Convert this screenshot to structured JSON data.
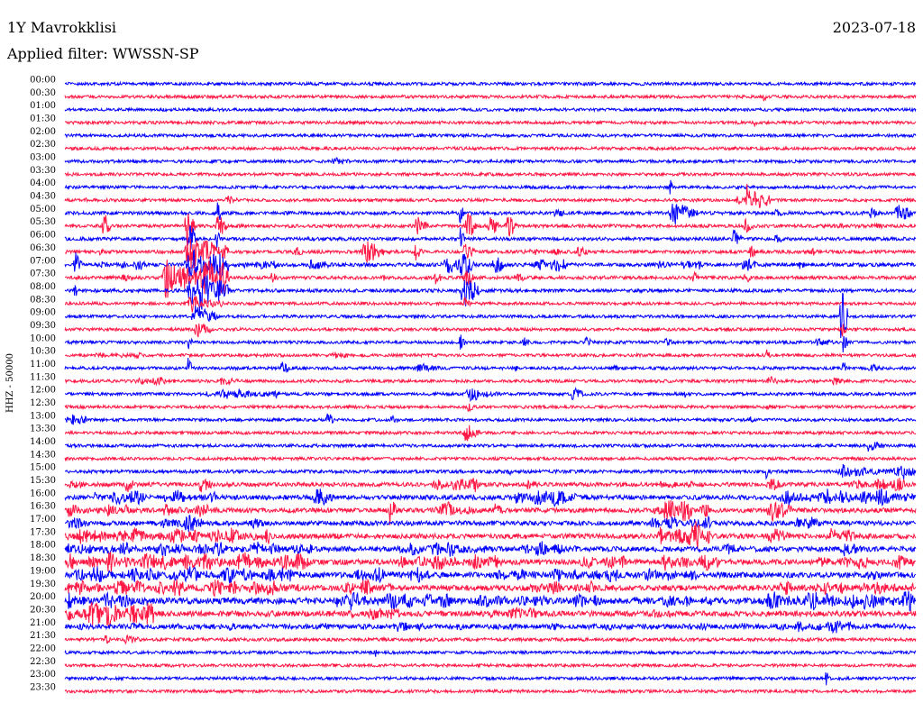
{
  "chart_data": {
    "type": "line",
    "title": "1Y Mavrokklisi",
    "date": "2023-07-18",
    "subtitle": "Applied filter: WWSSN-SP",
    "ylabel": "HHZ - 50000",
    "row_minutes": 30,
    "colors": [
      "#0000ff",
      "#ff1744"
    ],
    "rows": [
      {
        "time": "00:00",
        "noise": 1,
        "events": []
      },
      {
        "time": "00:30",
        "noise": 1,
        "events": [
          [
            24.6,
            24.75,
            3.5
          ]
        ]
      },
      {
        "time": "01:00",
        "noise": 1,
        "events": []
      },
      {
        "time": "01:30",
        "noise": 1,
        "events": [
          [
            24.3,
            24.4,
            3
          ]
        ]
      },
      {
        "time": "02:00",
        "noise": 1,
        "events": []
      },
      {
        "time": "02:30",
        "noise": 1,
        "events": []
      },
      {
        "time": "03:00",
        "noise": 1,
        "events": [
          [
            9.3,
            10.4,
            2.6
          ]
        ]
      },
      {
        "time": "03:30",
        "noise": 1,
        "events": []
      },
      {
        "time": "04:00",
        "noise": 1,
        "events": [
          [
            21.3,
            21.45,
            6
          ]
        ]
      },
      {
        "time": "04:30",
        "noise": 1,
        "events": [
          [
            0.7,
            0.9,
            2.5
          ],
          [
            5.6,
            6.3,
            3
          ],
          [
            23.6,
            24.9,
            7
          ],
          [
            24.0,
            24.2,
            12
          ]
        ]
      },
      {
        "time": "05:00",
        "noise": 1.1,
        "events": [
          [
            5.35,
            5.5,
            10
          ],
          [
            13.9,
            14.05,
            9
          ],
          [
            17.2,
            17.7,
            3.5
          ],
          [
            21.2,
            22.3,
            8
          ],
          [
            25.0,
            25.4,
            3
          ],
          [
            28.3,
            28.8,
            3.5
          ],
          [
            29.2,
            30.0,
            6
          ]
        ]
      },
      {
        "time": "05:30",
        "noise": 1.1,
        "events": [
          [
            1.3,
            1.6,
            10
          ],
          [
            4.2,
            4.6,
            12
          ],
          [
            5.3,
            5.7,
            9
          ],
          [
            12.3,
            12.8,
            7
          ],
          [
            14.1,
            14.5,
            11
          ],
          [
            14.9,
            15.3,
            8
          ],
          [
            15.5,
            16.0,
            8
          ],
          [
            23.9,
            24.3,
            5
          ],
          [
            27.0,
            29.5,
            2
          ]
        ]
      },
      {
        "time": "06:00",
        "noise": 1.1,
        "events": [
          [
            4.3,
            4.6,
            14
          ],
          [
            5.3,
            5.5,
            8
          ],
          [
            13.9,
            14.1,
            8
          ],
          [
            23.5,
            23.9,
            7
          ],
          [
            25.0,
            25.3,
            5
          ]
        ]
      },
      {
        "time": "06:30",
        "noise": 1.1,
        "events": [
          [
            1.2,
            1.4,
            4
          ],
          [
            4.2,
            5.8,
            12
          ],
          [
            8.0,
            8.4,
            5
          ],
          [
            10.4,
            11.3,
            8
          ],
          [
            12.3,
            12.6,
            6
          ],
          [
            14.0,
            14.5,
            6
          ],
          [
            16.1,
            17.5,
            3
          ],
          [
            18.0,
            18.5,
            4
          ],
          [
            24.1,
            24.5,
            5
          ],
          [
            26.3,
            26.6,
            3
          ]
        ]
      },
      {
        "time": "07:00",
        "noise": 1.2,
        "events": [
          [
            0.3,
            0.6,
            10
          ],
          [
            1.2,
            3.0,
            3.5
          ],
          [
            4.2,
            5.8,
            14
          ],
          [
            6.2,
            7.5,
            4
          ],
          [
            8.5,
            9.5,
            4
          ],
          [
            13.2,
            14.5,
            9
          ],
          [
            15.0,
            15.6,
            7
          ],
          [
            16.4,
            17.8,
            6
          ],
          [
            20.8,
            22.5,
            4
          ],
          [
            23.8,
            24.5,
            5
          ],
          [
            25.8,
            26.2,
            3
          ]
        ]
      },
      {
        "time": "07:30",
        "noise": 1.1,
        "events": [
          [
            1.0,
            3.3,
            2.5
          ],
          [
            3.4,
            5.8,
            14
          ],
          [
            7.2,
            7.6,
            4
          ],
          [
            11.0,
            11.4,
            4
          ],
          [
            13.0,
            13.3,
            5
          ],
          [
            14.0,
            14.5,
            6
          ],
          [
            15.9,
            16.3,
            4
          ],
          [
            22.1,
            22.4,
            4
          ],
          [
            23.9,
            24.2,
            5
          ]
        ]
      },
      {
        "time": "08:00",
        "noise": 1.1,
        "events": [
          [
            0.3,
            0.5,
            5
          ],
          [
            4.3,
            5.8,
            16
          ],
          [
            13.9,
            14.6,
            12
          ]
        ]
      },
      {
        "time": "08:30",
        "noise": 1,
        "events": [
          [
            4.3,
            5.6,
            7
          ],
          [
            14.0,
            14.3,
            5
          ]
        ]
      },
      {
        "time": "09:00",
        "noise": 1,
        "events": [
          [
            4.4,
            5.4,
            8
          ],
          [
            27.3,
            27.6,
            20
          ]
        ]
      },
      {
        "time": "09:30",
        "noise": 1,
        "events": [
          [
            4.5,
            5.2,
            6
          ],
          [
            27.35,
            27.55,
            6
          ]
        ]
      },
      {
        "time": "10:00",
        "noise": 1,
        "events": [
          [
            4.3,
            4.5,
            7
          ],
          [
            13.9,
            14.1,
            10
          ],
          [
            16.1,
            16.4,
            4
          ],
          [
            18.3,
            18.6,
            4
          ],
          [
            21.1,
            21.5,
            3
          ],
          [
            26.3,
            27.2,
            3
          ],
          [
            27.4,
            27.6,
            9
          ]
        ]
      },
      {
        "time": "10:30",
        "noise": 1,
        "events": [
          [
            0.8,
            2.8,
            2.5
          ],
          [
            9.3,
            10.4,
            2.5
          ],
          [
            24.7,
            24.9,
            4
          ]
        ]
      },
      {
        "time": "11:00",
        "noise": 1,
        "events": [
          [
            4.3,
            4.5,
            8
          ],
          [
            7.6,
            7.9,
            7
          ],
          [
            12.3,
            13.3,
            3.5
          ],
          [
            15.8,
            16.0,
            3
          ],
          [
            19.3,
            19.6,
            3
          ],
          [
            27.4,
            27.6,
            6
          ],
          [
            28.2,
            29.0,
            3
          ]
        ]
      },
      {
        "time": "11:30",
        "noise": 1,
        "events": [
          [
            2.2,
            4.0,
            3
          ],
          [
            5.3,
            6.3,
            3
          ],
          [
            24.7,
            25.2,
            4
          ],
          [
            27.0,
            27.6,
            3
          ]
        ]
      },
      {
        "time": "12:00",
        "noise": 1,
        "events": [
          [
            4.9,
            7.6,
            4
          ],
          [
            14.0,
            15.3,
            5
          ],
          [
            17.8,
            18.3,
            5
          ],
          [
            21.8,
            22.0,
            3
          ]
        ]
      },
      {
        "time": "12:30",
        "noise": 1,
        "events": [
          [
            14.1,
            14.4,
            5
          ],
          [
            24.7,
            24.9,
            3.5
          ]
        ]
      },
      {
        "time": "13:00",
        "noise": 1,
        "events": [
          [
            0.0,
            0.9,
            5
          ],
          [
            9.2,
            9.5,
            6
          ],
          [
            11.4,
            11.9,
            3
          ],
          [
            24.1,
            24.3,
            3
          ]
        ]
      },
      {
        "time": "13:30",
        "noise": 1,
        "events": [
          [
            14.0,
            14.6,
            7
          ]
        ]
      },
      {
        "time": "14:00",
        "noise": 1,
        "events": [
          [
            28.2,
            28.9,
            4.5
          ]
        ]
      },
      {
        "time": "14:30",
        "noise": 1,
        "events": []
      },
      {
        "time": "15:00",
        "noise": 1.1,
        "events": [
          [
            15.6,
            15.8,
            3
          ],
          [
            24.7,
            24.9,
            8
          ],
          [
            27.0,
            30.0,
            4
          ],
          [
            27.3,
            27.8,
            6
          ],
          [
            29.4,
            30.0,
            6
          ]
        ]
      },
      {
        "time": "15:30",
        "noise": 1.3,
        "events": [
          [
            0.0,
            0.9,
            4
          ],
          [
            2.1,
            2.5,
            6
          ],
          [
            4.7,
            5.2,
            7
          ],
          [
            12.9,
            14.6,
            6
          ],
          [
            16.1,
            16.8,
            4
          ],
          [
            20.9,
            22.2,
            4
          ],
          [
            24.7,
            25.4,
            5
          ],
          [
            27.6,
            30.0,
            5
          ]
        ]
      },
      {
        "time": "16:00",
        "noise": 1.5,
        "events": [
          [
            0.9,
            3.0,
            6
          ],
          [
            3.4,
            5.4,
            5
          ],
          [
            8.7,
            9.5,
            7
          ],
          [
            15.8,
            18.1,
            7
          ],
          [
            25.0,
            30.0,
            6
          ]
        ]
      },
      {
        "time": "16:30",
        "noise": 1.5,
        "events": [
          [
            0.0,
            2.8,
            5
          ],
          [
            3.4,
            5.4,
            5
          ],
          [
            11.4,
            11.7,
            10
          ],
          [
            13.0,
            14.6,
            6
          ],
          [
            15.0,
            15.6,
            5
          ],
          [
            20.6,
            22.8,
            8
          ],
          [
            24.7,
            25.7,
            8
          ]
        ]
      },
      {
        "time": "17:00",
        "noise": 1.5,
        "events": [
          [
            0.0,
            0.9,
            5
          ],
          [
            3.3,
            4.9,
            7
          ],
          [
            6.5,
            7.2,
            4
          ],
          [
            20.6,
            22.8,
            5
          ],
          [
            25.7,
            27.0,
            5
          ]
        ]
      },
      {
        "time": "17:30",
        "noise": 1.7,
        "events": [
          [
            0.0,
            7.3,
            6
          ],
          [
            20.9,
            22.8,
            10
          ],
          [
            24.7,
            25.7,
            6
          ],
          [
            26.9,
            28.2,
            6
          ]
        ]
      },
      {
        "time": "18:00",
        "noise": 1.7,
        "events": [
          [
            0.0,
            8.8,
            5
          ],
          [
            11.7,
            14.9,
            6
          ],
          [
            15.8,
            18.1,
            6
          ],
          [
            23.1,
            24.1,
            4
          ],
          [
            27.3,
            28.2,
            5
          ]
        ]
      },
      {
        "time": "18:30",
        "noise": 1.7,
        "events": [
          [
            0.0,
            8.8,
            7
          ],
          [
            11.7,
            15.5,
            6
          ],
          [
            18.1,
            19.9,
            6
          ],
          [
            20.9,
            23.1,
            7
          ],
          [
            26.3,
            30.0,
            5
          ]
        ]
      },
      {
        "time": "19:00",
        "noise": 1.8,
        "events": [
          [
            0.0,
            8.5,
            6
          ],
          [
            10.1,
            12.9,
            6
          ],
          [
            14.9,
            22.5,
            5
          ],
          [
            28.2,
            28.9,
            5
          ]
        ]
      },
      {
        "time": "19:30",
        "noise": 1.8,
        "events": [
          [
            0.0,
            8.5,
            6
          ],
          [
            9.5,
            11.7,
            6
          ],
          [
            16.1,
            18.7,
            5
          ],
          [
            25.0,
            30.0,
            5
          ]
        ]
      },
      {
        "time": "20:00",
        "noise": 2,
        "events": [
          [
            0.0,
            3.0,
            6
          ],
          [
            9.5,
            13.0,
            7
          ],
          [
            13.0,
            19.0,
            5
          ],
          [
            20.0,
            23.0,
            5
          ],
          [
            24.5,
            30.0,
            7
          ]
        ]
      },
      {
        "time": "20:30",
        "noise": 1.8,
        "events": [
          [
            0.0,
            3.2,
            10
          ],
          [
            9.8,
            12.0,
            5
          ],
          [
            14.9,
            16.8,
            5
          ],
          [
            20.0,
            22.0,
            3
          ]
        ]
      },
      {
        "time": "21:00",
        "noise": 1.5,
        "events": [
          [
            0.0,
            30.0,
            2.5
          ],
          [
            11.5,
            12.5,
            4
          ],
          [
            25.7,
            28.5,
            5
          ]
        ]
      },
      {
        "time": "21:30",
        "noise": 1.1,
        "events": [
          [
            1.4,
            1.6,
            8
          ],
          [
            2.0,
            2.8,
            3
          ]
        ]
      },
      {
        "time": "22:00",
        "noise": 1,
        "events": [
          [
            10.9,
            11.0,
            5
          ]
        ]
      },
      {
        "time": "22:30",
        "noise": 1,
        "events": []
      },
      {
        "time": "23:00",
        "noise": 1,
        "events": [
          [
            26.8,
            26.95,
            6
          ]
        ]
      },
      {
        "time": "23:30",
        "noise": 1,
        "events": []
      }
    ]
  }
}
